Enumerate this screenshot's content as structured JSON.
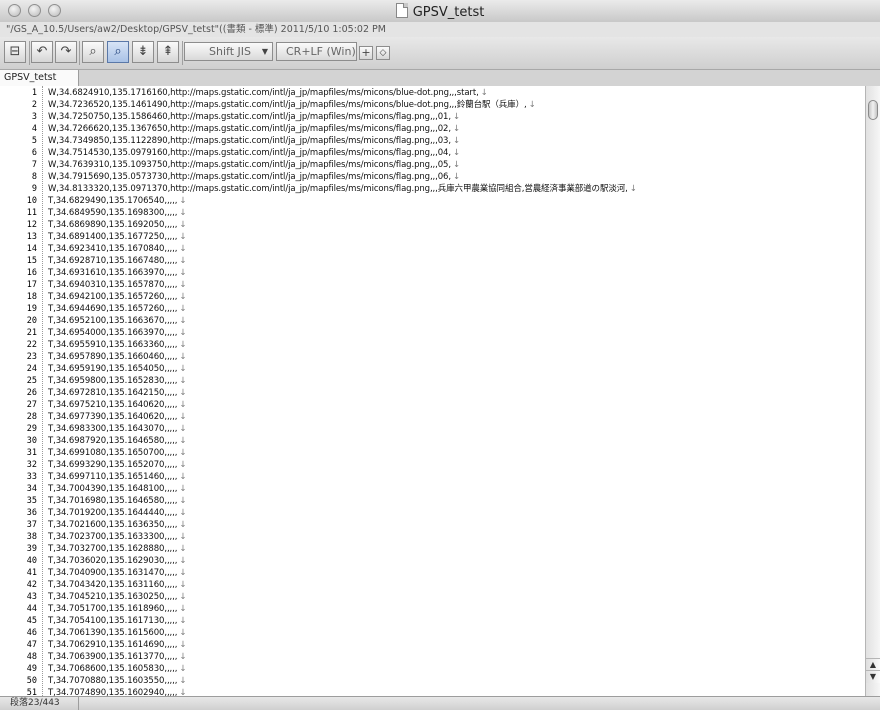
{
  "window": {
    "title": "GPSV_tetst"
  },
  "path_bar": {
    "text": "\"/GS_A_10.5/Users/aw2/Desktop/GPSV_tetst\"((書類 - 標準)    2011/5/10  1:05:02 PM"
  },
  "toolbar": {
    "buttons": [
      {
        "name": "save-button",
        "icon": "⊟"
      },
      {
        "name": "undo-button",
        "icon": "↶"
      },
      {
        "name": "redo-button",
        "icon": "↷"
      },
      {
        "name": "find-button",
        "icon": "⌕"
      },
      {
        "name": "find-selection-button",
        "icon": "⌕"
      },
      {
        "name": "find-next-button",
        "icon": "⇟"
      },
      {
        "name": "find-previous-button",
        "icon": "⇞"
      }
    ],
    "encoding": "Shift JIS",
    "line_ending": "CR+LF (Win)",
    "add_icon": "+",
    "diamond_icon": "◇"
  },
  "tab": {
    "label": "GPSV_tetst"
  },
  "editor": {
    "eol_mark": "↓",
    "lines": [
      {
        "n": "1",
        "text": "W,34.6824910,135.1716160,http://maps.gstatic.com/intl/ja_jp/mapfiles/ms/micons/blue-dot.png,,,start,"
      },
      {
        "n": "2",
        "text": "W,34.7236520,135.1461490,http://maps.gstatic.com/intl/ja_jp/mapfiles/ms/micons/blue-dot.png,,,鈴蘭台駅（兵庫）,"
      },
      {
        "n": "3",
        "text": "W,34.7250750,135.1586460,http://maps.gstatic.com/intl/ja_jp/mapfiles/ms/micons/flag.png,,,01,"
      },
      {
        "n": "4",
        "text": "W,34.7266620,135.1367650,http://maps.gstatic.com/intl/ja_jp/mapfiles/ms/micons/flag.png,,,02,"
      },
      {
        "n": "5",
        "text": "W,34.7349850,135.1122890,http://maps.gstatic.com/intl/ja_jp/mapfiles/ms/micons/flag.png,,,03,"
      },
      {
        "n": "6",
        "text": "W,34.7514530,135.0979160,http://maps.gstatic.com/intl/ja_jp/mapfiles/ms/micons/flag.png,,,04,"
      },
      {
        "n": "7",
        "text": "W,34.7639310,135.1093750,http://maps.gstatic.com/intl/ja_jp/mapfiles/ms/micons/flag.png,,,05,"
      },
      {
        "n": "8",
        "text": "W,34.7915690,135.0573730,http://maps.gstatic.com/intl/ja_jp/mapfiles/ms/micons/flag.png,,,06,"
      },
      {
        "n": "9",
        "text": "W,34.8133320,135.0971370,http://maps.gstatic.com/intl/ja_jp/mapfiles/ms/micons/flag.png,,,兵庫六甲農業協同組合,営農経済事業部道の駅淡河,"
      },
      {
        "n": "10",
        "text": "T,34.6829490,135.1706540,,,,,"
      },
      {
        "n": "11",
        "text": "T,34.6849590,135.1698300,,,,,"
      },
      {
        "n": "12",
        "text": "T,34.6869890,135.1692050,,,,,"
      },
      {
        "n": "13",
        "text": "T,34.6891400,135.1677250,,,,,"
      },
      {
        "n": "14",
        "text": "T,34.6923410,135.1670840,,,,,"
      },
      {
        "n": "15",
        "text": "T,34.6928710,135.1667480,,,,,"
      },
      {
        "n": "16",
        "text": "T,34.6931610,135.1663970,,,,,"
      },
      {
        "n": "17",
        "text": "T,34.6940310,135.1657870,,,,,"
      },
      {
        "n": "18",
        "text": "T,34.6942100,135.1657260,,,,,"
      },
      {
        "n": "19",
        "text": "T,34.6944690,135.1657260,,,,,"
      },
      {
        "n": "20",
        "text": "T,34.6952100,135.1663670,,,,,"
      },
      {
        "n": "21",
        "text": "T,34.6954000,135.1663970,,,,,"
      },
      {
        "n": "22",
        "text": "T,34.6955910,135.1663360,,,,,"
      },
      {
        "n": "23",
        "text": "T,34.6957890,135.1660460,,,,,"
      },
      {
        "n": "24",
        "text": "T,34.6959190,135.1654050,,,,,"
      },
      {
        "n": "25",
        "text": "T,34.6959800,135.1652830,,,,,"
      },
      {
        "n": "26",
        "text": "T,34.6972810,135.1642150,,,,,"
      },
      {
        "n": "27",
        "text": "T,34.6975210,135.1640620,,,,,"
      },
      {
        "n": "28",
        "text": "T,34.6977390,135.1640620,,,,,"
      },
      {
        "n": "29",
        "text": "T,34.6983300,135.1643070,,,,,"
      },
      {
        "n": "30",
        "text": "T,34.6987920,135.1646580,,,,,"
      },
      {
        "n": "31",
        "text": "T,34.6991080,135.1650700,,,,,"
      },
      {
        "n": "32",
        "text": "T,34.6993290,135.1652070,,,,,"
      },
      {
        "n": "33",
        "text": "T,34.6997110,135.1651460,,,,,"
      },
      {
        "n": "34",
        "text": "T,34.7004390,135.1648100,,,,,"
      },
      {
        "n": "35",
        "text": "T,34.7016980,135.1646580,,,,,"
      },
      {
        "n": "36",
        "text": "T,34.7019200,135.1644440,,,,,"
      },
      {
        "n": "37",
        "text": "T,34.7021600,135.1636350,,,,,"
      },
      {
        "n": "38",
        "text": "T,34.7023700,135.1633300,,,,,"
      },
      {
        "n": "39",
        "text": "T,34.7032700,135.1628880,,,,,"
      },
      {
        "n": "40",
        "text": "T,34.7036020,135.1629030,,,,,"
      },
      {
        "n": "41",
        "text": "T,34.7040900,135.1631470,,,,,"
      },
      {
        "n": "42",
        "text": "T,34.7043420,135.1631160,,,,,"
      },
      {
        "n": "43",
        "text": "T,34.7045210,135.1630250,,,,,"
      },
      {
        "n": "44",
        "text": "T,34.7051700,135.1618960,,,,,"
      },
      {
        "n": "45",
        "text": "T,34.7054100,135.1617130,,,,,"
      },
      {
        "n": "46",
        "text": "T,34.7061390,135.1615600,,,,,"
      },
      {
        "n": "47",
        "text": "T,34.7062910,135.1614690,,,,,"
      },
      {
        "n": "48",
        "text": "T,34.7063900,135.1613770,,,,,"
      },
      {
        "n": "49",
        "text": "T,34.7068600,135.1605830,,,,,"
      },
      {
        "n": "50",
        "text": "T,34.7070880,135.1603550,,,,,"
      },
      {
        "n": "51",
        "text": "T,34.7074890,135.1602940,,,,,"
      }
    ]
  },
  "status_bar": {
    "text": "段落23/443"
  }
}
